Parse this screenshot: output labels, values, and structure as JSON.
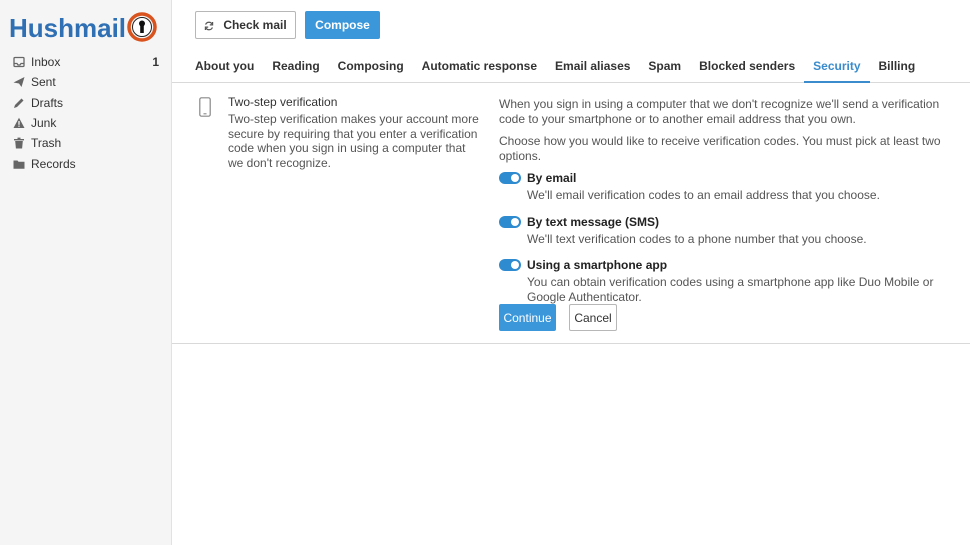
{
  "app": {
    "logo_text": "Hushmail",
    "colors": {
      "logo_text": "#2f6fb3",
      "logo_ring": "#d9531e",
      "accent": "#3b97d9",
      "active_tab": "#3b8ccc"
    }
  },
  "sidebar": {
    "folders": [
      {
        "label": "Inbox",
        "icon": "inbox-icon",
        "count": "1"
      },
      {
        "label": "Sent",
        "icon": "paper-plane-icon"
      },
      {
        "label": "Drafts",
        "icon": "pencil-icon"
      },
      {
        "label": "Junk",
        "icon": "warning-icon"
      },
      {
        "label": "Trash",
        "icon": "trash-icon"
      },
      {
        "label": "Records",
        "icon": "folder-icon"
      }
    ]
  },
  "toolbar": {
    "check_mail_label": "Check mail",
    "compose_label": "Compose"
  },
  "tabs": [
    {
      "label": "About you"
    },
    {
      "label": "Reading"
    },
    {
      "label": "Composing"
    },
    {
      "label": "Automatic response"
    },
    {
      "label": "Email aliases"
    },
    {
      "label": "Spam"
    },
    {
      "label": "Blocked senders"
    },
    {
      "label": "Security",
      "active": true
    },
    {
      "label": "Billing"
    }
  ],
  "security": {
    "title": "Two-step verification",
    "description": "Two-step verification makes your account more secure by requiring that you enter a verification code when you sign in using a computer that we don't recognize.",
    "intro": "When you sign in using a computer that we don't recognize we'll send a verification code to your smartphone or to another email address that you own.",
    "choose": "Choose how you would like to receive verification codes. You must pick at least two options.",
    "options": [
      {
        "title": "By email",
        "desc": "We'll email verification codes to an email address that you choose.",
        "enabled": true
      },
      {
        "title": "By text message (SMS)",
        "desc": "We'll text verification codes to a phone number that you choose.",
        "enabled": true
      },
      {
        "title": "Using a smartphone app",
        "desc": "You can obtain verification codes using a smartphone app like Duo Mobile or Google Authenticator.",
        "enabled": true
      }
    ],
    "continue_label": "Continue",
    "cancel_label": "Cancel"
  }
}
